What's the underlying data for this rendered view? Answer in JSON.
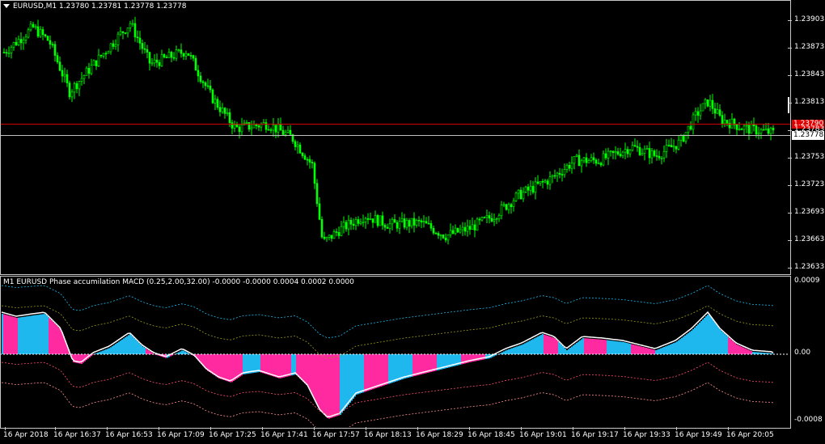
{
  "chart": {
    "symbol_header": "EURUSD,M1  1.23780 1.23781 1.23778 1.23778",
    "ask_price": "1.23790",
    "bid_price": "1.23778",
    "price_labels": [
      "1.23903",
      "1.23873",
      "1.23843",
      "1.23813",
      "1.23783",
      "1.23753",
      "1.23723",
      "1.23693",
      "1.23663",
      "1.23633"
    ],
    "candle_color": "#00ff00",
    "ask_line_color": "#d00000",
    "bid_line_color": "#c0c0c0"
  },
  "indicator": {
    "title": "M1 EURUSD Phase accumilation MACD (0.25,2.00,32.00) -0.0000 -0.0000 0.0004 0.0002 0.0000",
    "scale_labels": [
      "0.0009",
      "0.00",
      "-0.0008"
    ],
    "colors": {
      "positive": "#ff2aa0",
      "negative": "#1fb8ee",
      "signal": "#ffffff"
    }
  },
  "time_axis": {
    "labels": [
      "16 Apr 2018",
      "16 Apr 16:37",
      "16 Apr 16:53",
      "16 Apr 17:09",
      "16 Apr 17:25",
      "16 Apr 17:41",
      "16 Apr 17:57",
      "16 Apr 18:13",
      "16 Apr 18:29",
      "16 Apr 18:45",
      "16 Apr 19:01",
      "16 Apr 19:17",
      "16 Apr 19:33",
      "16 Apr 19:49",
      "16 Apr 20:05"
    ]
  },
  "chart_data": {
    "type": "line",
    "title": "EURUSD,M1",
    "ylim": [
      1.23633,
      1.23915
    ],
    "x": [
      "16 Apr 2018",
      "16 Apr 16:37",
      "16 Apr 16:53",
      "16 Apr 17:09",
      "16 Apr 17:25",
      "16 Apr 17:41",
      "16 Apr 17:57",
      "16 Apr 18:13",
      "16 Apr 18:29",
      "16 Apr 18:45",
      "16 Apr 19:01",
      "16 Apr 19:17",
      "16 Apr 19:33",
      "16 Apr 19:49",
      "16 Apr 20:05"
    ],
    "series": [
      {
        "name": "EURUSD,M1",
        "values": [
          1.2387,
          1.2385,
          1.2387,
          1.2386,
          1.238,
          1.2378,
          1.2365,
          1.2368,
          1.2368,
          1.2369,
          1.2373,
          1.2375,
          1.2376,
          1.2381,
          1.2378
        ]
      }
    ]
  }
}
